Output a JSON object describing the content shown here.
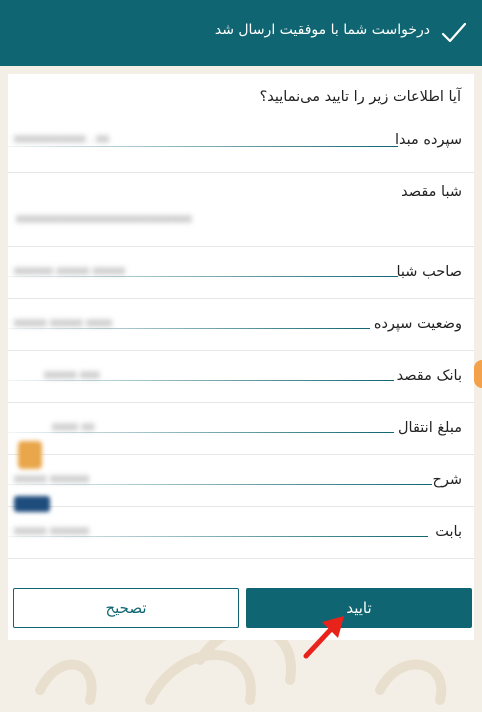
{
  "header": {
    "title": "درخواست شما با موفقیت ارسال شد",
    "icon": "check-icon"
  },
  "form": {
    "question": "آیا اطلاعات زیر را تایید می‌نمایید؟",
    "rows": [
      {
        "label": "سپرده مبدا",
        "value": "xxxxxxxxxxx . xx"
      },
      {
        "label": "شبا مقصد",
        "value": "xxxxxxxxxxxxxxxxxxxxxxxxxxx"
      },
      {
        "label": "صاحب شبا",
        "value": "xxxxxx xxxxx xxxxx"
      },
      {
        "label": "وضعیت سپرده",
        "value": "xxxxx xxxxx xxxx"
      },
      {
        "label": "بانک مقصد",
        "value": "xxxxx xxx"
      },
      {
        "label": "مبلغ انتقال",
        "value": "xxxx xx"
      },
      {
        "label": "شرح",
        "value": "xxxxx xxxxxx"
      },
      {
        "label": "بابت",
        "value": "xxxxx xxxxxx"
      }
    ]
  },
  "buttons": {
    "confirm": "تایید",
    "correct": "تصحیح"
  },
  "colors": {
    "primary": "#0f6571",
    "background": "#f4efe6",
    "arrow": "#e8231b"
  }
}
